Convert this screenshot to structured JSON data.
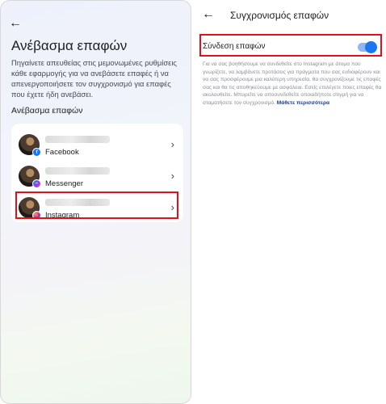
{
  "left": {
    "title": "Ανέβασμα επαφών",
    "description": "Πηγαίνετε απευθείας στις μεμονωμένες ρυθμίσεις κάθε εφαρμογής για να ανεβάσετε επαφές ή να απενεργοποιήσετε τον συγχρονισμό για επαφές που έχετε ήδη ανεβάσει.",
    "section_title": "Ανέβασμα επαφών",
    "accounts": [
      {
        "platform": "Facebook",
        "badge_icon": "facebook-icon"
      },
      {
        "platform": "Messenger",
        "badge_icon": "messenger-icon"
      },
      {
        "platform": "Instagram",
        "badge_icon": "instagram-icon"
      }
    ]
  },
  "right": {
    "title": "Συγχρονισμός επαφών",
    "toggle_label": "Σύνδεση επαφών",
    "toggle_on": true,
    "info_text": "Για να σας βοηθήσουμε να συνδεθείτε στο Instagram με άτομα που γνωρίζετε, να λαμβάνετε προτάσεις για πράγματα που σας ενδιαφέρουν και να σας προσφέρουμε μια καλύτερη υπηρεσία, θα συγχρονίζουμε τις επαφές σας και θα τις αποθηκεύουμε με ασφάλεια. Εσείς επιλέγετε ποιες επαφές θα ακολουθείτε. Μπορείτε να αποσυνδεθείτε οποιαδήποτε στιγμή για να σταματήσετε τον συγχρονισμό.",
    "learn_more": "Μάθετε περισσότερα"
  },
  "colors": {
    "highlight": "#e3101c",
    "toggle_on": "#1877f2",
    "link": "#1c3f8c"
  }
}
